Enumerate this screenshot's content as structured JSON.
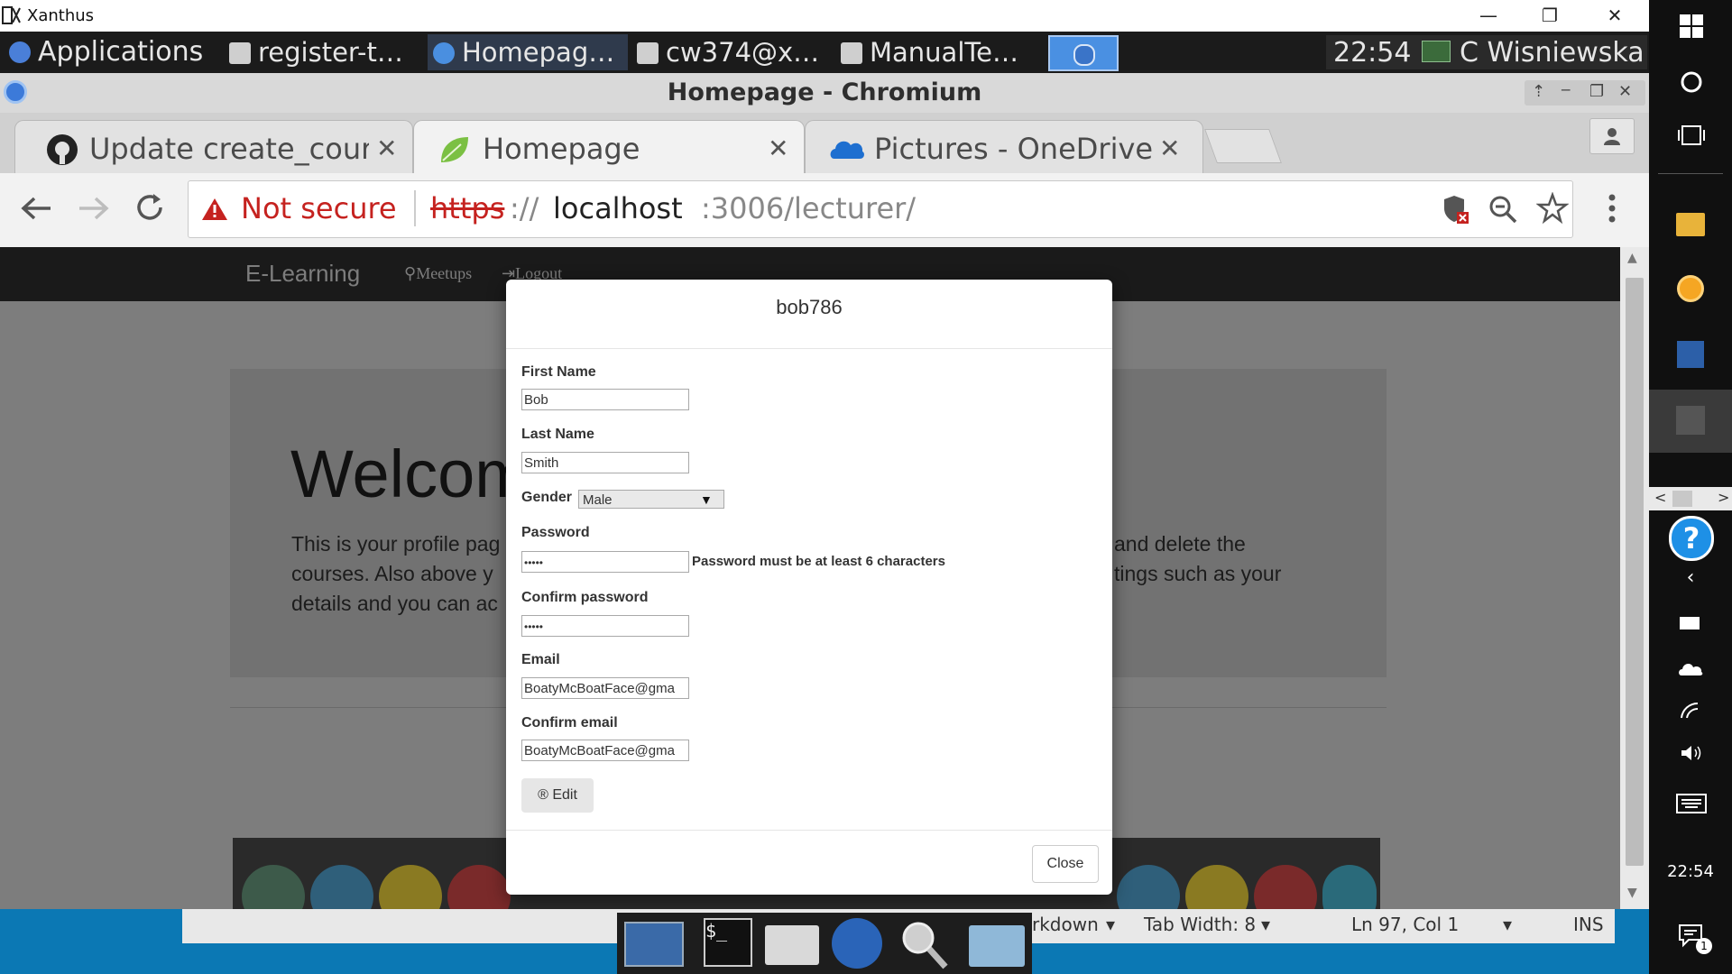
{
  "xwindow": {
    "title": "Xanthus",
    "minimize": "—",
    "restore": "❐",
    "close": "✕"
  },
  "panel": {
    "applications_label": "Applications",
    "tasks": [
      {
        "label": "register-t…"
      },
      {
        "label": "Homepag…"
      },
      {
        "label": "cw374@x…"
      },
      {
        "label": "ManualTe…"
      }
    ],
    "clock": "22:54",
    "user": "C Wisniewska"
  },
  "browser": {
    "window_title": "Homepage - Chromium",
    "tabs": [
      {
        "label": "Update create_cours"
      },
      {
        "label": "Homepage"
      },
      {
        "label": "Pictures - OneDrive"
      }
    ],
    "security_label": "Not secure",
    "url_scheme": "https",
    "url_sep": "://",
    "url_host": "localhost",
    "url_rest": ":3006/lecturer/"
  },
  "site": {
    "brand": "E-Learning",
    "nav": [
      {
        "label": "Meetups"
      },
      {
        "label": "Logout"
      }
    ],
    "welcome": "Welcom",
    "intro_left": [
      "This is your profile pag",
      "courses. Also above y",
      "details and you can ac"
    ],
    "intro_right": [
      "and delete the",
      "tings such as your"
    ]
  },
  "modal": {
    "title": "bob786",
    "first_name_label": "First Name",
    "first_name": "Bob",
    "last_name_label": "Last Name",
    "last_name": "Smith",
    "gender_label": "Gender",
    "gender": "Male",
    "password_label": "Password",
    "password_mask": "•••••",
    "password_error": "Password must be at least 6 characters",
    "confirm_password_label": "Confirm password",
    "confirm_password_mask": "•••••",
    "email_label": "Email",
    "email": "BoatyMcBoatFace@gma",
    "confirm_email_label": "Confirm email",
    "confirm_email": "BoatyMcBoatFace@gma",
    "edit_label": "Edit",
    "close_label": "Close"
  },
  "editor_status": {
    "mode": "rkdown",
    "tab_width": "Tab Width: 8",
    "position": "Ln 97, Col 1",
    "ins": "INS"
  },
  "winbar": {
    "clock": "22:54",
    "notif_count": "1"
  },
  "colors": {
    "panel_bg": "#1b1b1b",
    "warning_red": "#c5221f",
    "taskbar_blue": "#0b78b4",
    "navbar_bg": "#1a1a1a"
  }
}
